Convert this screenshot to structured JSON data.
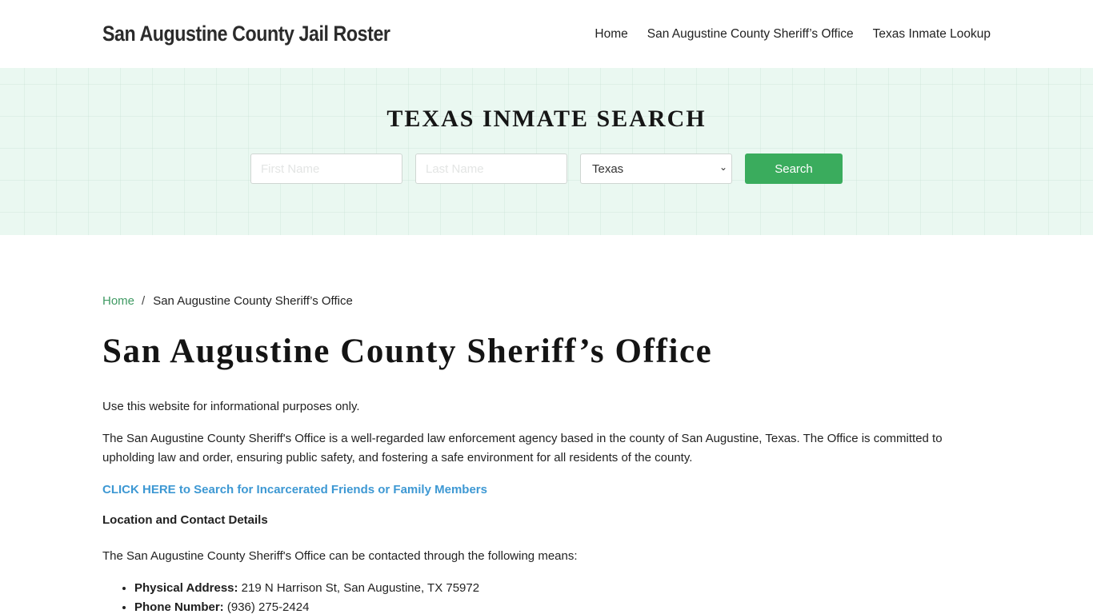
{
  "header": {
    "site_title": "San Augustine County Jail Roster",
    "nav": [
      {
        "label": "Home"
      },
      {
        "label": "San Augustine County Sheriff’s Office"
      },
      {
        "label": "Texas Inmate Lookup"
      }
    ]
  },
  "hero": {
    "title": "TEXAS INMATE SEARCH",
    "first_name_placeholder": "First Name",
    "last_name_placeholder": "Last Name",
    "state_selected": "Texas",
    "search_label": "Search",
    "chevron_glyph": "⌄"
  },
  "breadcrumb": {
    "home": "Home",
    "separator": "/",
    "current": "San Augustine County Sheriff’s Office"
  },
  "main": {
    "title": "San Augustine County Sheriff’s Office",
    "disclaimer": "Use this website for informational purposes only.",
    "intro": "The San Augustine County Sheriff's Office is a well-regarded law enforcement agency based in the county of San Augustine, Texas. The Office is committed to upholding law and order, ensuring public safety, and fostering a safe environment for all residents of the county.",
    "cta_link": "CLICK HERE to Search for Incarcerated Friends or Family Members",
    "section_heading": "Location and Contact Details",
    "means_text": "The San Augustine County Sheriff's Office can be contacted through the following means:",
    "contacts": [
      {
        "label": "Physical Address:",
        "value": " 219 N Harrison St, San Augustine, TX 75972"
      },
      {
        "label": "Phone Number:",
        "value": " (936) 275-2424"
      }
    ]
  },
  "colors": {
    "accent_green": "#3aac5d",
    "link_blue": "#3d98d3",
    "breadcrumb_green": "#3f9a63",
    "hero_bg": "#eaf8f1"
  }
}
